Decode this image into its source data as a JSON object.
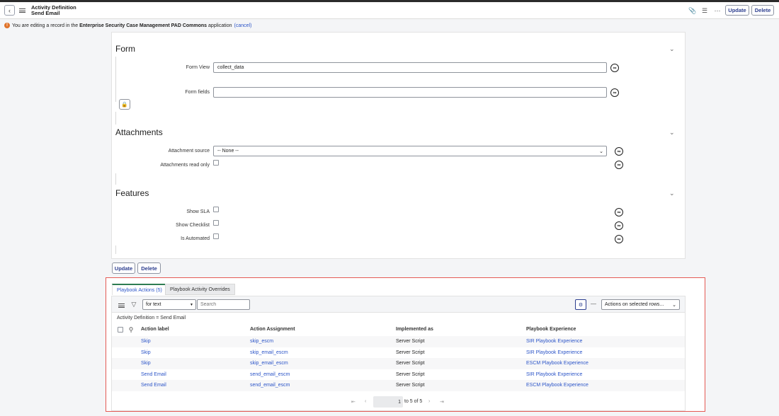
{
  "header": {
    "title_line1": "Activity Definition",
    "title_line2": "Send Email",
    "update_label": "Update",
    "delete_label": "Delete"
  },
  "notice": {
    "prefix": "You are editing a record in the",
    "app_name": "Enterprise Security Case Management PAD Commons",
    "suffix": "application",
    "cancel": "(cancel)"
  },
  "form": {
    "title": "Form",
    "form_view_label": "Form View",
    "form_view_value": "collect_data",
    "form_fields_label": "Form fields",
    "form_fields_value": ""
  },
  "attachments": {
    "title": "Attachments",
    "source_label": "Attachment source",
    "source_value": "-- None --",
    "read_only_label": "Attachments read only"
  },
  "features": {
    "title": "Features",
    "show_sla": "Show SLA",
    "show_checklist": "Show Checklist",
    "is_automated": "Is Automated"
  },
  "footer_buttons": {
    "update": "Update",
    "delete": "Delete"
  },
  "related": {
    "tabs": [
      "Playbook Actions (5)",
      "Playbook Activity Overrides"
    ],
    "search_field": "for text",
    "search_placeholder": "Search",
    "actions_select": "Actions on selected rows...",
    "filter_text": "Activity Definition = Send Email",
    "columns": [
      "Action label",
      "Action Assignment",
      "Implemented as",
      "Playbook Experience"
    ],
    "rows": [
      [
        "Skip",
        "skip_escm",
        "Server Script",
        "SIR Playbook Experience"
      ],
      [
        "Skip",
        "skip_email_escm",
        "Server Script",
        "SIR Playbook Experience"
      ],
      [
        "Skip",
        "skip_email_escm",
        "Server Script",
        "ESCM Playbook Experience"
      ],
      [
        "Send Email",
        "send_email_escm",
        "Server Script",
        "SIR Playbook Experience"
      ],
      [
        "Send Email",
        "send_email_escm",
        "Server Script",
        "ESCM Playbook Experience"
      ]
    ],
    "pager": {
      "current": "1",
      "range": "to 5 of 5"
    }
  }
}
